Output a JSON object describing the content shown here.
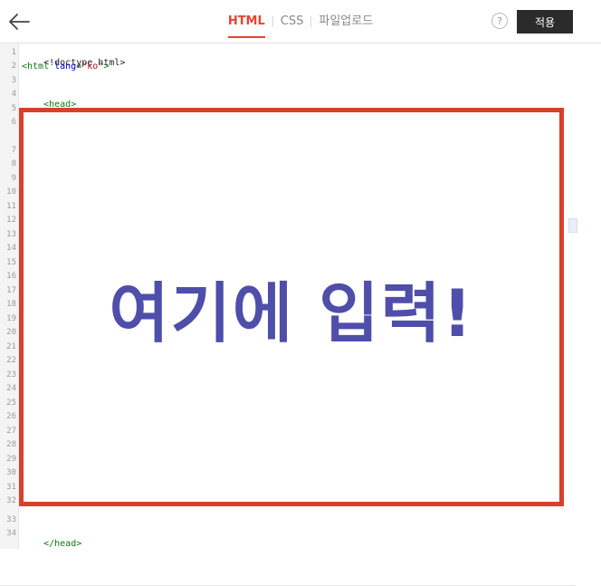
{
  "header": {
    "tabs": [
      {
        "label": "HTML",
        "active": true
      },
      {
        "label": "CSS",
        "active": false
      },
      {
        "label": "파일업로드",
        "active": false
      }
    ],
    "help_label": "?",
    "apply_label": "적용",
    "back_icon": "arrow-left-icon"
  },
  "editor": {
    "line_numbers": [
      "1",
      "2",
      "3",
      "4",
      "5",
      "6",
      "7",
      "8",
      "9",
      "10",
      "11",
      "12",
      "13",
      "14",
      "15",
      "16",
      "17",
      "18",
      "19",
      "20",
      "21",
      "22",
      "23",
      "24",
      "25",
      "26",
      "27",
      "28",
      "29",
      "30",
      "31",
      "32",
      "33",
      "34"
    ],
    "lines": {
      "l1": "<!doctype html>",
      "l2_open": "<html ",
      "l2_attr": "lang",
      "l2_eq": "=",
      "l2_val": "\"ko\"",
      "l2_close": ">",
      "l4": "<head>",
      "l34": "</head>"
    }
  },
  "callout": {
    "text": "여기에 입력!"
  },
  "colors": {
    "accent": "#e5452f",
    "highlight_border": "#d8402c",
    "callout_text": "#4f4eaa",
    "apply_bg": "#2b2b2b"
  }
}
